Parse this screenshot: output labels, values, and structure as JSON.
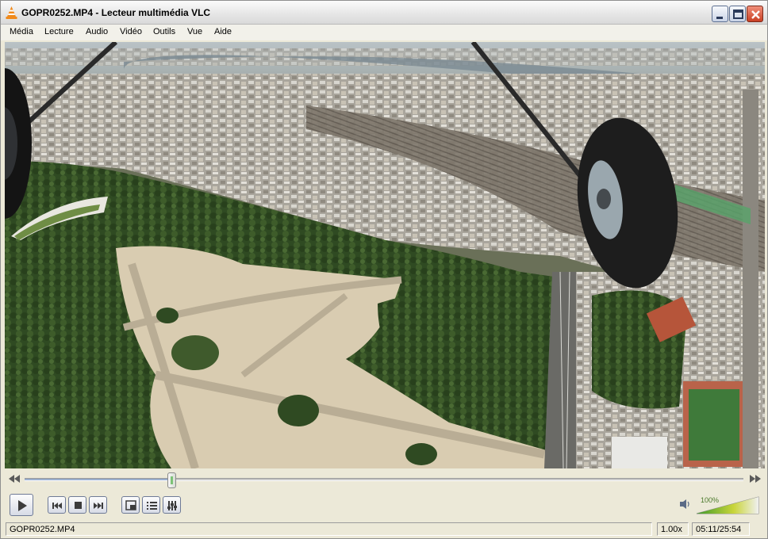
{
  "window": {
    "title": "GOPR0252.MP4 - Lecteur multimédia VLC"
  },
  "menu": [
    "Média",
    "Lecture",
    "Audio",
    "Vidéo",
    "Outils",
    "Vue",
    "Aide"
  ],
  "playback": {
    "progress_fraction": 0.204,
    "volume_label": "100%",
    "volume_fraction": 1.0
  },
  "status": {
    "filename": "GOPR0252.MP4",
    "speed": "1.00x",
    "time": "05:11/25:54"
  },
  "colors": {
    "vlc_orange": "#f08a1c",
    "volume_green": "#4b9a2a",
    "close_red": "#c93f23"
  },
  "icons": {
    "app": "vlc-cone-icon",
    "play": "play-icon",
    "prev": "previous-icon",
    "stop": "stop-icon",
    "next": "next-icon",
    "fullscreen": "fullscreen-icon",
    "playlist": "playlist-icon",
    "settings": "extended-settings-icon",
    "volume": "speaker-icon"
  }
}
